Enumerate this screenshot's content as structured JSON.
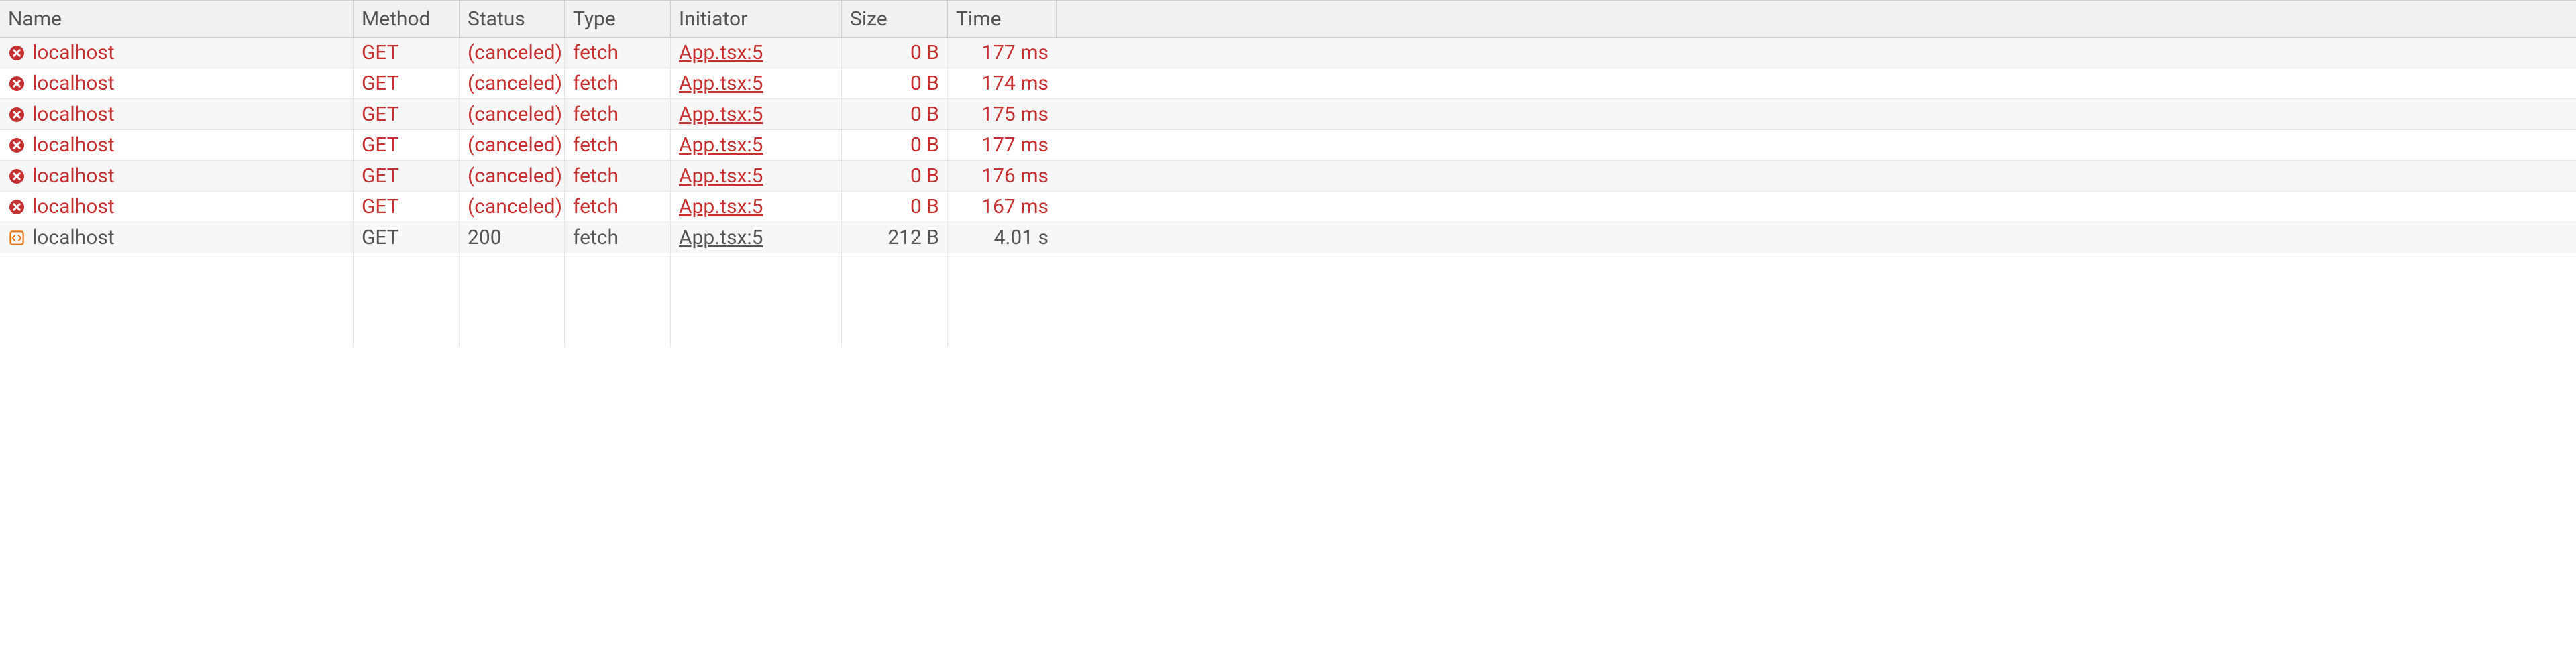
{
  "columns": {
    "name": "Name",
    "method": "Method",
    "status": "Status",
    "type": "Type",
    "initiator": "Initiator",
    "size": "Size",
    "time": "Time"
  },
  "rows": [
    {
      "name": "localhost",
      "method": "GET",
      "status": "(canceled)",
      "type": "fetch",
      "initiator": "App.tsx:5",
      "size": "0 B",
      "time": "177 ms",
      "error": true,
      "icon": "error"
    },
    {
      "name": "localhost",
      "method": "GET",
      "status": "(canceled)",
      "type": "fetch",
      "initiator": "App.tsx:5",
      "size": "0 B",
      "time": "174 ms",
      "error": true,
      "icon": "error"
    },
    {
      "name": "localhost",
      "method": "GET",
      "status": "(canceled)",
      "type": "fetch",
      "initiator": "App.tsx:5",
      "size": "0 B",
      "time": "175 ms",
      "error": true,
      "icon": "error"
    },
    {
      "name": "localhost",
      "method": "GET",
      "status": "(canceled)",
      "type": "fetch",
      "initiator": "App.tsx:5",
      "size": "0 B",
      "time": "177 ms",
      "error": true,
      "icon": "error"
    },
    {
      "name": "localhost",
      "method": "GET",
      "status": "(canceled)",
      "type": "fetch",
      "initiator": "App.tsx:5",
      "size": "0 B",
      "time": "176 ms",
      "error": true,
      "icon": "error"
    },
    {
      "name": "localhost",
      "method": "GET",
      "status": "(canceled)",
      "type": "fetch",
      "initiator": "App.tsx:5",
      "size": "0 B",
      "time": "167 ms",
      "error": true,
      "icon": "error"
    },
    {
      "name": "localhost",
      "method": "GET",
      "status": "200",
      "type": "fetch",
      "initiator": "App.tsx:5",
      "size": "212 B",
      "time": "4.01 s",
      "error": false,
      "icon": "script"
    }
  ]
}
